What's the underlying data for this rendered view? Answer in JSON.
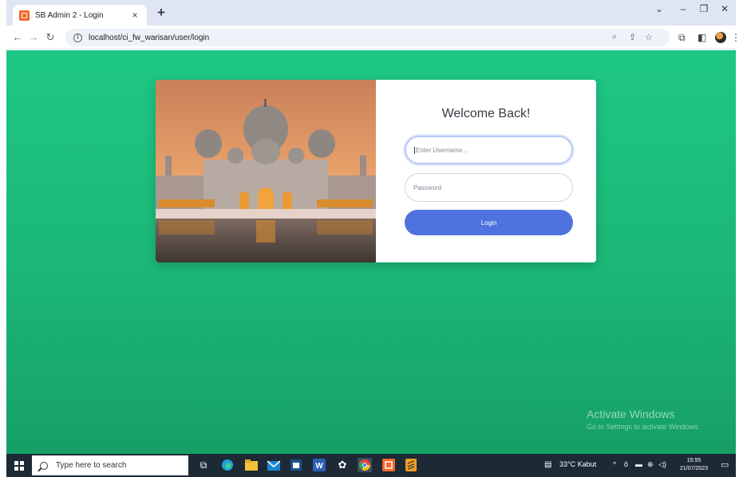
{
  "browser": {
    "tab_title": "SB Admin 2 - Login",
    "tab_close": "×",
    "new_tab": "+",
    "url": "localhost/ci_fw_warisan/user/login",
    "window_controls": [
      "⌄",
      "–",
      "❐",
      "✕"
    ]
  },
  "login": {
    "heading": "Welcome Back!",
    "username_placeholder": "Enter Username...",
    "password_placeholder": "Password",
    "button_label": "Login"
  },
  "watermark": {
    "title": "Activate Windows",
    "subtitle": "Go to Settings to activate Windows."
  },
  "taskbar": {
    "search_placeholder": "Type here to search",
    "weather": "33°C  Kabut",
    "time": "15:55",
    "date": "21/07/2023"
  },
  "colors": {
    "page_gradient_top": "#1ec785",
    "page_gradient_bottom": "#169f67",
    "button": "#4e73df",
    "tab_accent": "#f6672a",
    "taskbar": "#1d2a35"
  },
  "icons": {
    "back": "arrow-left-icon",
    "forward": "arrow-right-icon",
    "reload": "reload-icon",
    "info": "info-icon",
    "zoom": "zoom-icon",
    "share": "share-icon",
    "bookmark": "star-icon",
    "extensions": "puzzle-icon",
    "sidepanel": "side-panel-icon",
    "menu": "kebab-menu-icon"
  }
}
